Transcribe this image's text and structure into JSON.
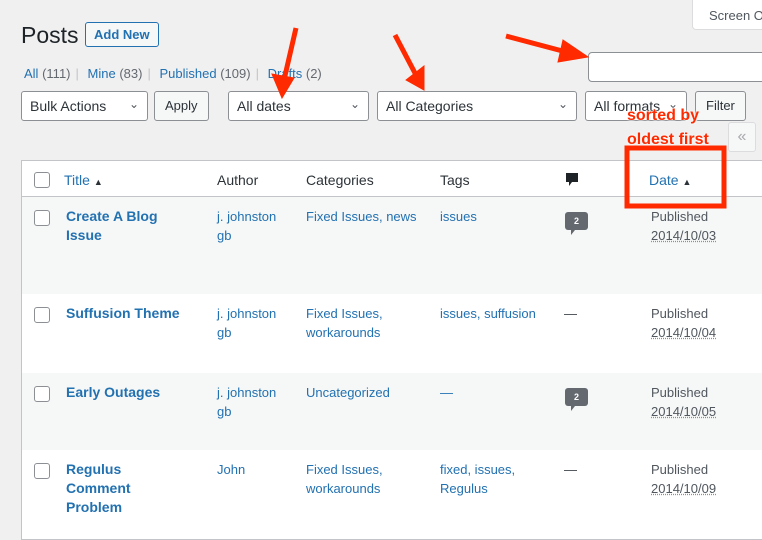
{
  "screen_options": "Screen O",
  "page_title": "Posts",
  "add_new": "Add New",
  "views": [
    {
      "label": "All",
      "count": "(111)"
    },
    {
      "label": "Mine",
      "count": "(83)"
    },
    {
      "label": "Published",
      "count": "(109)"
    },
    {
      "label": "Drafts",
      "count": "(2)"
    }
  ],
  "filters": {
    "bulk_actions": "Bulk Actions",
    "apply": "Apply",
    "dates": "All dates",
    "categories": "All Categories",
    "formats": "All formats",
    "filter": "Filter",
    "search_value": ""
  },
  "pagination": {
    "first": "«"
  },
  "columns": {
    "title": "Title",
    "author": "Author",
    "categories": "Categories",
    "tags": "Tags",
    "date": "Date",
    "sort_indicator": "▲"
  },
  "rows": [
    {
      "title": "Create A Blog Issue",
      "author": "j. johnston gb",
      "categories": "Fixed Issues, news",
      "tags": "issues",
      "comments": "2",
      "status": "Published",
      "date": "2014/10/03"
    },
    {
      "title": "Suffusion Theme",
      "author": "j. johnston gb",
      "categories": "Fixed Issues, workarounds",
      "tags": "issues, suffusion",
      "comments": "—",
      "status": "Published",
      "date": "2014/10/04"
    },
    {
      "title": "Early Outages",
      "author": "j. johnston gb",
      "categories": "Uncategorized",
      "tags": "—",
      "comments": "2",
      "status": "Published",
      "date": "2014/10/05"
    },
    {
      "title": "Regulus Comment Problem",
      "author": "John",
      "categories": "Fixed Issues, workarounds",
      "tags": "fixed, issues, Regulus",
      "comments": "—",
      "status": "Published",
      "date": "2014/10/09"
    }
  ],
  "annotation": {
    "text": "sorted by oldest first",
    "color": "#ff2a00"
  }
}
